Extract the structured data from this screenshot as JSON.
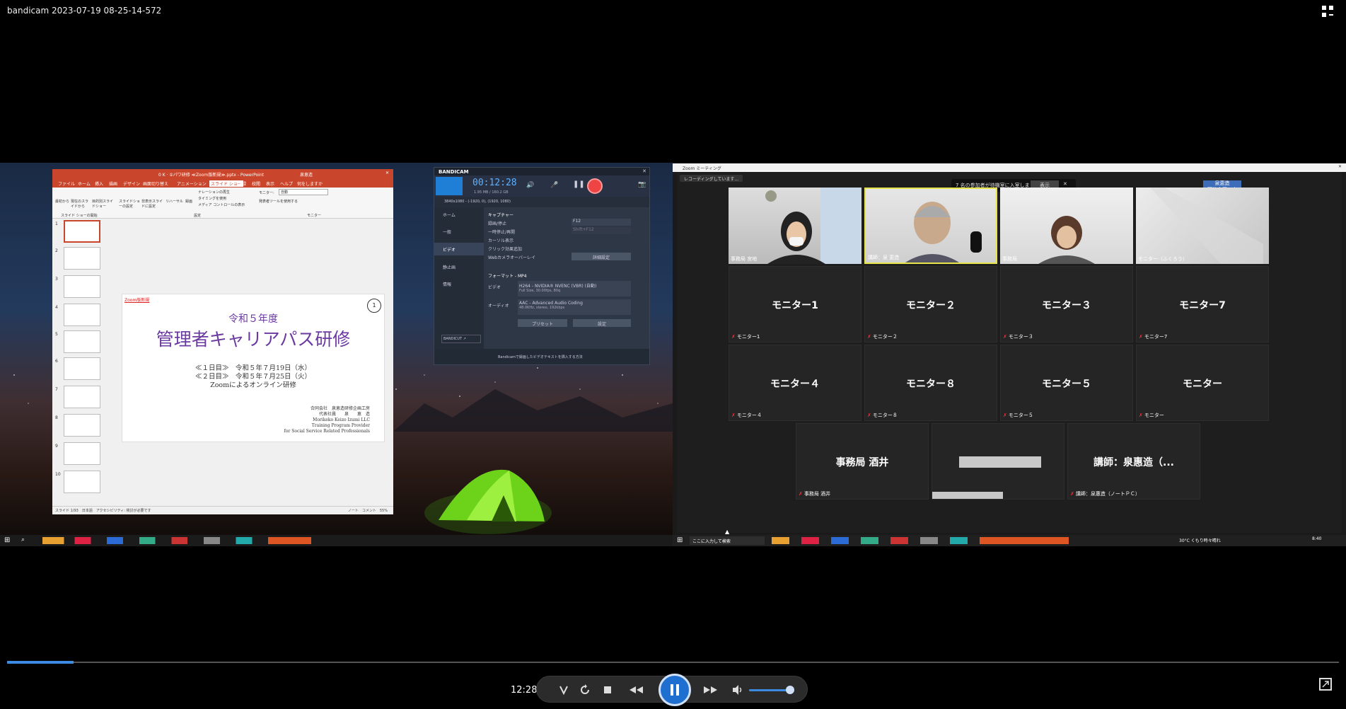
{
  "window_title": "bandicam 2023-07-19 08-25-14-572",
  "powerpoint": {
    "title": "0 K · ①パワ研修 ≪Zoom版新規≫.pptx - PowerPoint",
    "user": "泉恵造",
    "menu": [
      "ファイル",
      "ホーム",
      "挿入",
      "描画",
      "デザイン",
      "画面切り替え",
      "アニメーション",
      "スライド ショー",
      "記録",
      "校閲",
      "表示",
      "ヘルプ",
      "何をしますか"
    ],
    "ribbon_items": [
      "最初から",
      "現在のスライドから",
      "目的別スライドショー",
      "スライドショーの設定",
      "非表示スライドに設定",
      "リハーサル",
      "録画",
      "ナレーションの再生",
      "タイミングを使用",
      "メディア コントロールの表示",
      "モニター:",
      "自動",
      "発表者ツールを使用する"
    ],
    "ribbon_groups": [
      "スライド ショーの開始",
      "設定",
      "モニター"
    ],
    "thumb_numbers": [
      "1",
      "2",
      "3",
      "4",
      "5",
      "6",
      "7",
      "8",
      "9",
      "10"
    ],
    "slide": {
      "tag": "Zoom版新規",
      "page": "1",
      "subtitle": "令和５年度",
      "title": "管理者キャリアパス研修",
      "line1": "≪１日目≫　令和５年７月19日（水）",
      "line2": "≪２日目≫　令和５年７月25日（火）",
      "line3": "Zoomによるオンライン研修",
      "company1": "合同会社　泉恵造研修企画工房",
      "company2": "代表社員　　泉　　恵　造",
      "company3": "Morikeko Keizo Izumi LLC",
      "company4": "Training Program Provider",
      "company5": "for Social Service Related Professionals"
    },
    "status": "スライド 1/93　日本語　アクセシビリティ: 検討が必要です",
    "status_right": "ノート　コメント　55%"
  },
  "bandicam": {
    "brand": "BANDICAM",
    "timer": "00:12:28",
    "size": "1.95 MB / 160.2 GB",
    "resolution": "3840x1080 - (-1920, 0), (1920, 1080)",
    "sidebar": [
      "ホーム",
      "一般",
      "ビデオ",
      "静止画",
      "情報"
    ],
    "capture_header": "キャプチャー",
    "options": [
      "録画/停止",
      "一時停止/再開",
      "カーソル表示",
      "クリック効果追加",
      "Webカメラオーバーレイ"
    ],
    "hotkey": "F12",
    "hotkey2": "Shift+F12",
    "detail_btn": "詳細設定",
    "format_header": "フォーマット - MP4",
    "video_label": "ビデオ",
    "video_codec": "H264 - NVIDIA® NVENC (VBR) (自動)",
    "video_detail": "Full Size, 30.00fps, 80q",
    "audio_label": "オーディオ",
    "audio_codec": "AAC - Advanced Audio Coding",
    "audio_detail": "48.0KHz, stereo, 192kbps",
    "preset_btn": "プリセット",
    "settings_btn": "設定",
    "bandicut": "BANDICUT ↗",
    "footer": "Bandicamで録画したビデオテキストを挿入する方法"
  },
  "zoom": {
    "title": "Zoom ミーティング",
    "recording": "レコーディングしています...",
    "waiting": "7 名の参加者が待機室に入室しました",
    "show_btn": "表示",
    "brand_badge": "泉恵造\n研修企画工房",
    "video_tiles": [
      {
        "label": "事務局 宮地"
      },
      {
        "label": "講師：泉 恵造"
      },
      {
        "label": "事務局"
      },
      {
        "label": "モニター（ふくろう）"
      }
    ],
    "name_tiles": [
      {
        "name": "モニター1",
        "label": "モニター1"
      },
      {
        "name": "モニター２",
        "label": "モニター２"
      },
      {
        "name": "モニター３",
        "label": "モニター３"
      },
      {
        "name": "モニター7",
        "label": "モニター7"
      },
      {
        "name": "モニター４",
        "label": "モニター４"
      },
      {
        "name": "モニター８",
        "label": "モニター８"
      },
      {
        "name": "モニター５",
        "label": "モニター５"
      },
      {
        "name": "モニター",
        "label": "モニター"
      }
    ],
    "bottom_tiles": [
      {
        "name": "事務局 酒井",
        "label": "事務局 酒井"
      },
      {
        "name": "",
        "label": ""
      },
      {
        "name": "講師：泉惠造（...",
        "label": "講師：泉惠造（ノートＰＣ）"
      }
    ],
    "taskbar_search": "ここに入力して検索",
    "weather": "30°C くもり時々晴れ",
    "clock": "8:40"
  },
  "player": {
    "time": "12:28",
    "progress": 0.05,
    "volume": 0.9
  }
}
